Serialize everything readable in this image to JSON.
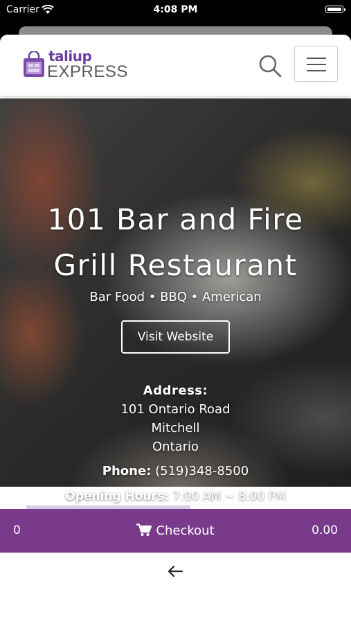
{
  "status": {
    "carrier": "Carrier",
    "time": "4:08 PM"
  },
  "header": {
    "logo_top": "taliup",
    "logo_bottom": "EXPRESS"
  },
  "restaurant": {
    "name_line1": "101 Bar and Fire",
    "name_line2": "Grill Restaurant",
    "cuisines": "Bar Food • BBQ • American",
    "visit_label": "Visit Website",
    "address_label": "Address:",
    "address_lines": [
      "101 Ontario Road",
      "Mitchell",
      "Ontario"
    ],
    "phone_label": "Phone:",
    "phone": "(519)348-8500",
    "hours_label": "Opening Hours:",
    "hours": "7:00 AM ~ 8:00 PM"
  },
  "checkout": {
    "count": "0",
    "label": "Checkout",
    "total": "0.00"
  },
  "colors": {
    "accent": "#7a3a8c",
    "logo_purple": "#6b3fa0"
  },
  "icons": [
    "wifi-icon",
    "battery-icon",
    "search-icon",
    "menu-icon",
    "cart-icon",
    "back-arrow-icon"
  ]
}
